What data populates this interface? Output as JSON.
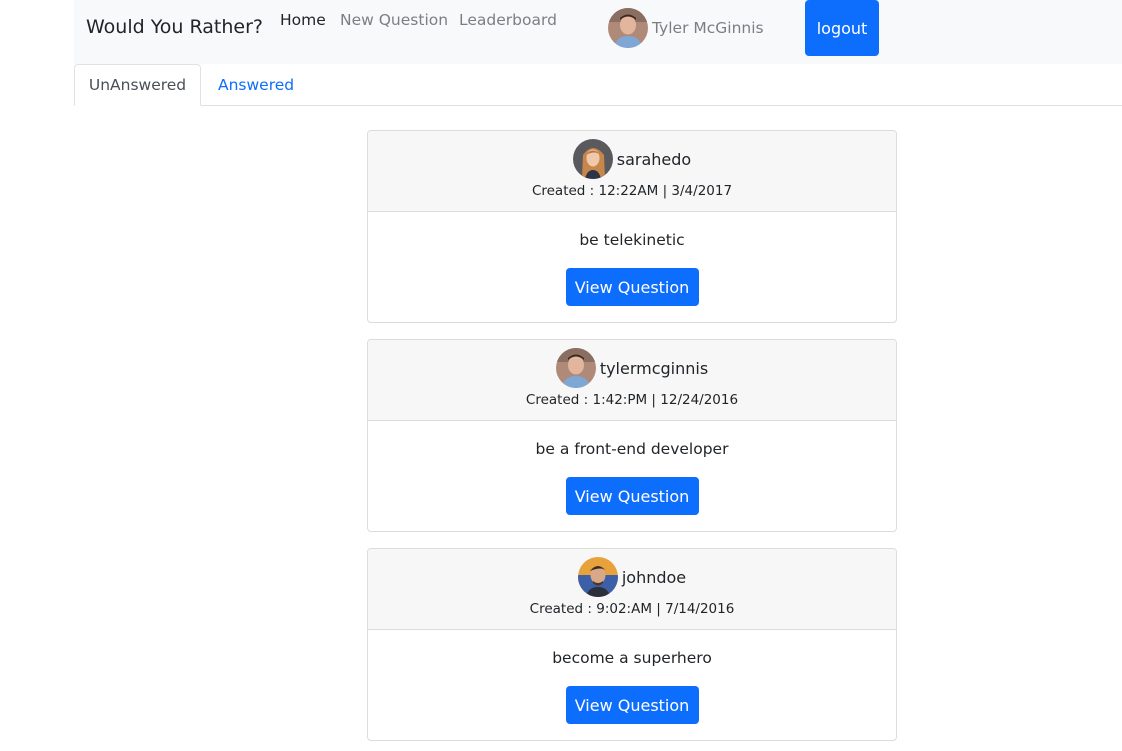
{
  "navbar": {
    "brand": "Would You Rather?",
    "links": [
      {
        "label": "Home",
        "active": true
      },
      {
        "label": "New Question",
        "active": false
      },
      {
        "label": "Leaderboard",
        "active": false
      }
    ],
    "user_name": "Tyler McGinnis",
    "logout_label": "logout"
  },
  "tabs": [
    {
      "label": "UnAnswered",
      "active": true
    },
    {
      "label": "Answered",
      "active": false
    }
  ],
  "questions": [
    {
      "author": "sarahedo",
      "created": "Created : 12:22AM | 3/4/2017",
      "text": "be telekinetic",
      "button": "View Question",
      "avatar_icon": "woman-avatar"
    },
    {
      "author": "tylermcginnis",
      "created": "Created : 1:42:PM | 12/24/2016",
      "text": "be a front-end developer",
      "button": "View Question",
      "avatar_icon": "man-avatar"
    },
    {
      "author": "johndoe",
      "created": "Created : 9:02:AM | 7/14/2016",
      "text": "become a superhero",
      "button": "View Question",
      "avatar_icon": "man-avatar"
    }
  ],
  "colors": {
    "primary": "#0d6efd",
    "navbar_bg": "#f8f9fa",
    "card_header_bg": "#f7f7f7"
  }
}
